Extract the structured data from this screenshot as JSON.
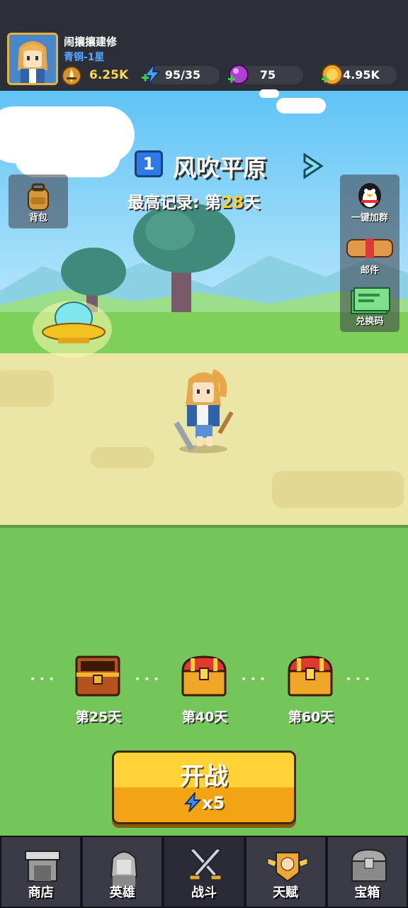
{
  "player": {
    "name": "闹攘攘建修",
    "rank": "青铜-1星",
    "power": "6.25K"
  },
  "resources": {
    "energy": "95/35",
    "gems": "75",
    "coins": "4.95K"
  },
  "stage": {
    "number": "1",
    "name": "风吹平原",
    "record_prefix": "最高记录: 第",
    "record_day": "28",
    "record_suffix": "天"
  },
  "side_left": {
    "backpack": "背包"
  },
  "side_right": {
    "join_group": "一键加群",
    "mail": "邮件",
    "redeem": "兑换码"
  },
  "chests": [
    {
      "label": "第25天",
      "state": "open"
    },
    {
      "label": "第40天",
      "state": "closed"
    },
    {
      "label": "第60天",
      "state": "closed"
    }
  ],
  "battle": {
    "label": "开战",
    "cost": "x5"
  },
  "nav": [
    {
      "label": "商店",
      "icon": "shop-icon"
    },
    {
      "label": "英雄",
      "icon": "hero-icon"
    },
    {
      "label": "战斗",
      "icon": "crossed-swords-icon"
    },
    {
      "label": "天赋",
      "icon": "talent-fist-icon"
    },
    {
      "label": "宝箱",
      "icon": "treasure-chest-icon"
    }
  ],
  "colors": {
    "accent_yellow": "#ffd338",
    "button_orange": "#f3a415",
    "nav_bg": "#3a3b46",
    "stage_blue": "#2c79e8"
  }
}
